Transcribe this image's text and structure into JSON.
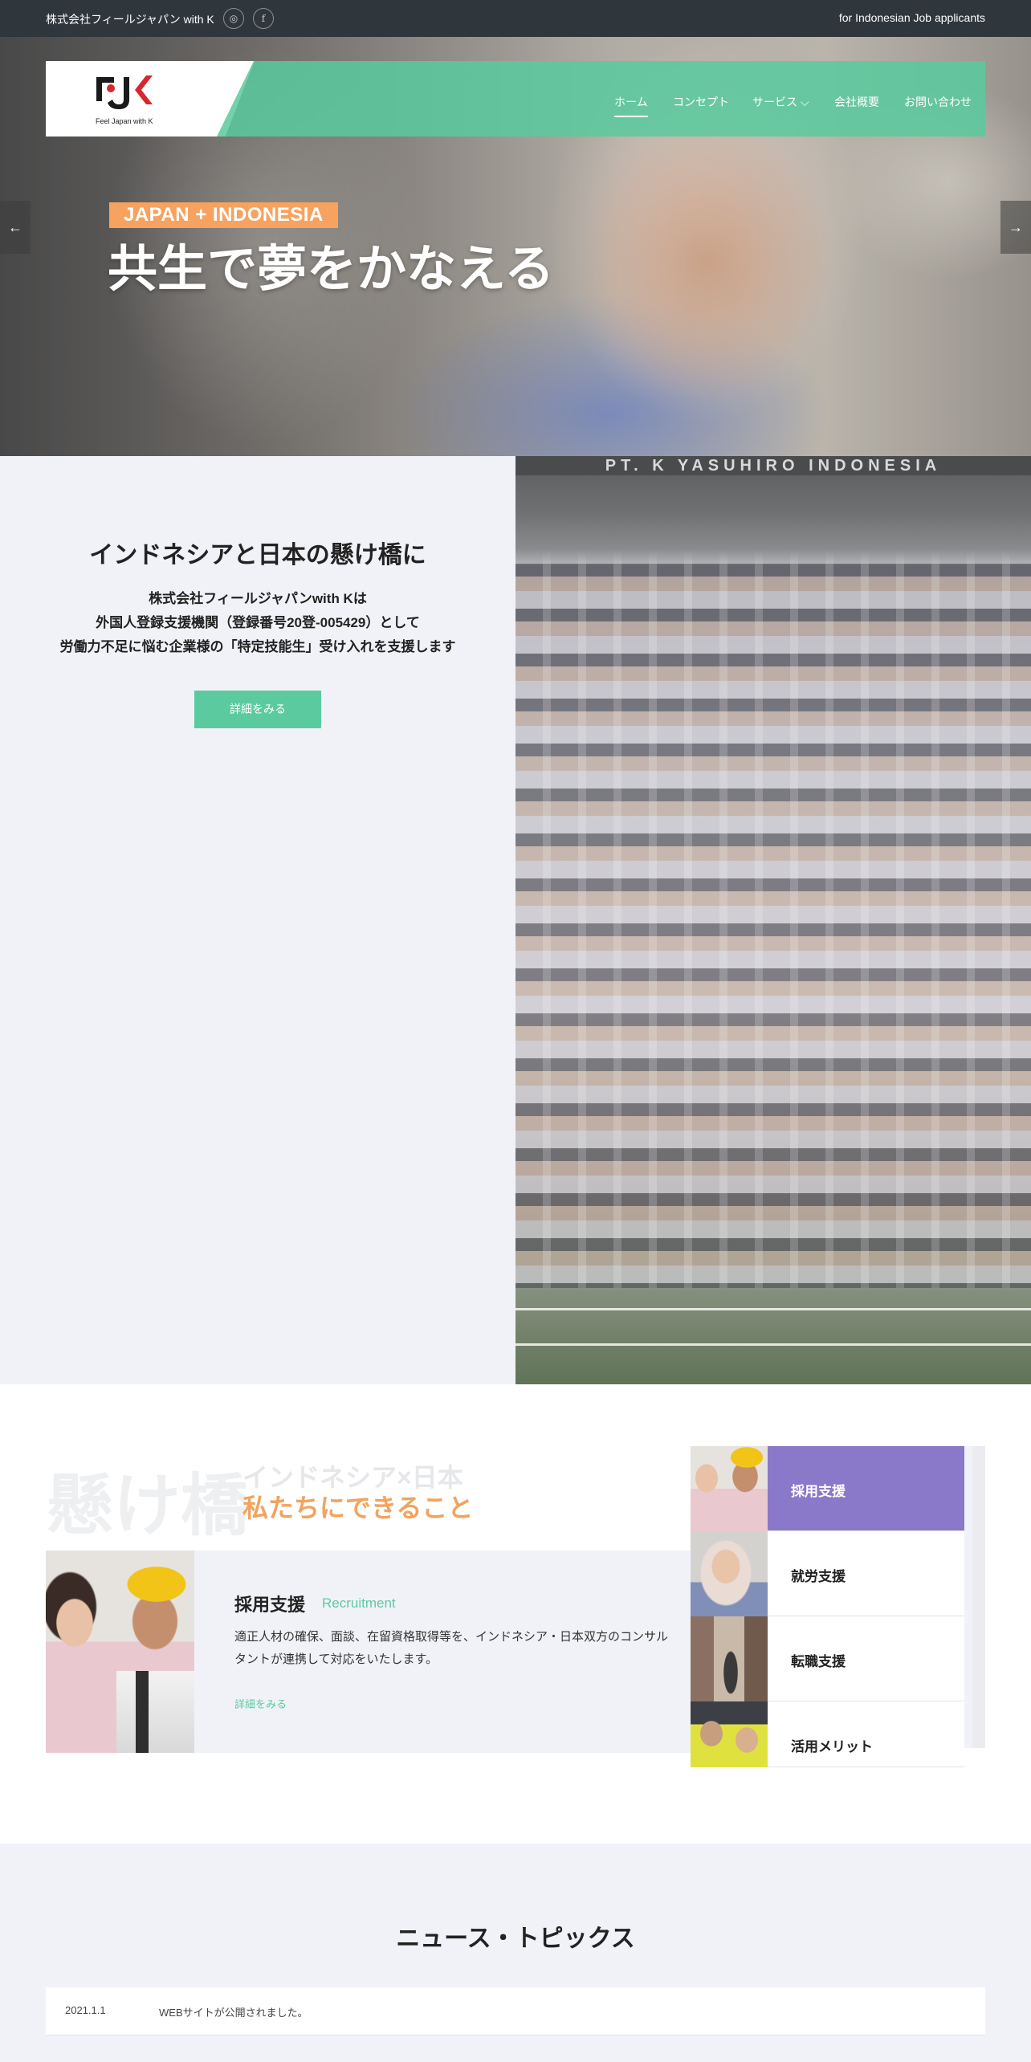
{
  "topbar": {
    "company": "株式会社フィールジャパン with K",
    "instagram_icon": "◎",
    "facebook_icon": "f",
    "applicants_link": "for Indonesian Job applicants"
  },
  "header": {
    "logo_text": "Feel Japan with K",
    "nav": [
      {
        "label": "ホーム"
      },
      {
        "label": "コンセプト"
      },
      {
        "label": "サービス ⌵"
      },
      {
        "label": "会社概要"
      },
      {
        "label": "お問い合わせ"
      }
    ],
    "accent_color": "#58ca9e"
  },
  "hero": {
    "tag": "JAPAN + INDONESIA",
    "headline": "共生で夢をかなえる",
    "prev_arrow": "←",
    "next_arrow": "→",
    "tag_color": "#f7a25f"
  },
  "intro": {
    "title": "インドネシアと日本の懸け橋に",
    "lines": [
      "株式会社フィールジャパンwith Kは",
      "外国人登録支援機関（登録番号20登-005429）として",
      "労働力不足に悩む企業様の「特定技能生」受け入れを支援します"
    ],
    "button": "詳細をみる",
    "photo_sign": "PT. K YASUHIRO INDONESIA"
  },
  "services": {
    "big_kanji": "懸け橋",
    "subtitle1": "インドネシア×日本",
    "subtitle2": "私たちにできること",
    "card": {
      "title": "採用支援",
      "title_en": "Recruitment",
      "description": "適正人材の確保、面談、在留資格取得等を、インドネシア・日本双方のコンサルタントが連携して対応をいたします。",
      "link": "詳細をみる"
    },
    "tabs": [
      {
        "label": "採用支援"
      },
      {
        "label": "就労支援"
      },
      {
        "label": "転職支援"
      },
      {
        "label": "活用メリット"
      }
    ],
    "active_tab_color": "#8a78c8"
  },
  "news": {
    "title": "ニュース・トピックス",
    "items": [
      {
        "date": "2021.1.1",
        "text": "WEBサイトが公開されました。"
      }
    ]
  }
}
